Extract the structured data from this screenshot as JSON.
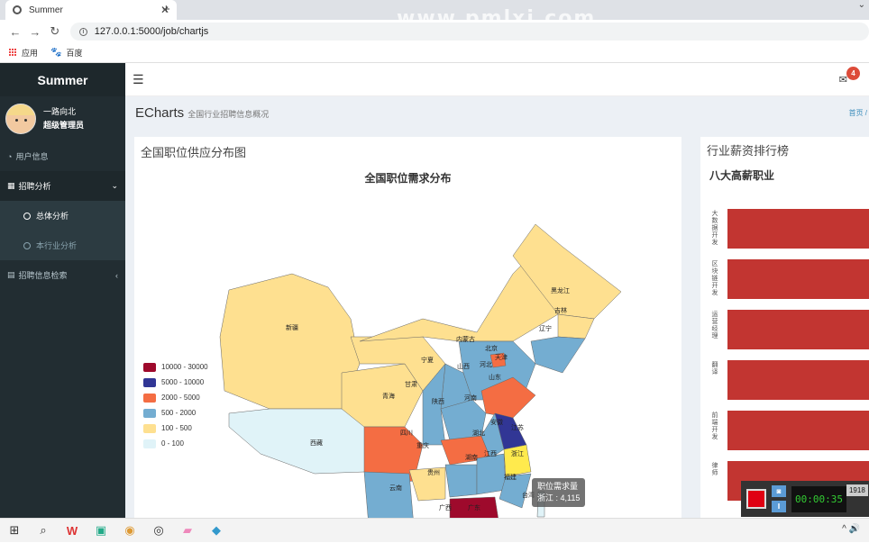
{
  "browser": {
    "tab_title": "Summer",
    "url": "127.0.0.1:5000/job/chartjs",
    "bookmarks": [
      "应用",
      "百度"
    ],
    "watermark": "www.pmlxj.com"
  },
  "sidebar": {
    "brand": "Summer",
    "user_name": "一路向北",
    "user_role": "超级管理员",
    "items": [
      {
        "label": "用户信息"
      },
      {
        "label": "招聘分析"
      },
      {
        "label": "总体分析"
      },
      {
        "label": "本行业分析"
      },
      {
        "label": "招聘信息检索"
      }
    ]
  },
  "topnav": {
    "mail_count": "4"
  },
  "header": {
    "title": "ECharts",
    "subtitle": "全国行业招聘信息概况",
    "breadcrumb": "首页 /"
  },
  "map_box": {
    "box_title": "全国职位供应分布图",
    "chart_title": "全国职位需求分布",
    "legend": [
      {
        "label": "10000 - 30000",
        "color": "#9e0a2c"
      },
      {
        "label": "5000 - 10000",
        "color": "#313695"
      },
      {
        "label": "2000 - 5000",
        "color": "#f46d43"
      },
      {
        "label": "500 - 2000",
        "color": "#74add1"
      },
      {
        "label": "100 - 500",
        "color": "#fee090"
      },
      {
        "label": "0 - 100",
        "color": "#e0f3f8"
      }
    ],
    "tooltip_title": "职位需求量",
    "tooltip_value": "浙江 : 4,115",
    "provinces": [
      "新疆",
      "西藏",
      "青海",
      "甘肃",
      "宁夏",
      "内蒙古",
      "黑龙江",
      "吉林",
      "辽宁",
      "北京",
      "天津",
      "河北",
      "山西",
      "山东",
      "陕西",
      "河南",
      "四川",
      "重庆",
      "湖北",
      "安徽",
      "江苏",
      "浙江",
      "湖南",
      "江西",
      "贵州",
      "云南",
      "福建",
      "广西",
      "广东",
      "台湾"
    ]
  },
  "chart_data": {
    "type": "bar",
    "title": "八大高薪职业",
    "categories": [
      "大数据开发",
      "区块链开发",
      "运营经理",
      "翻译",
      "前端开发",
      "律师"
    ],
    "values": [
      100,
      100,
      100,
      95,
      91,
      87
    ],
    "orientation": "horizontal"
  },
  "right_box": {
    "box_title": "行业薪资排行榜"
  },
  "recorder": {
    "time": "00:00:35",
    "tag": "1918"
  },
  "taskbar": {
    "tray": "^ 🔊"
  }
}
